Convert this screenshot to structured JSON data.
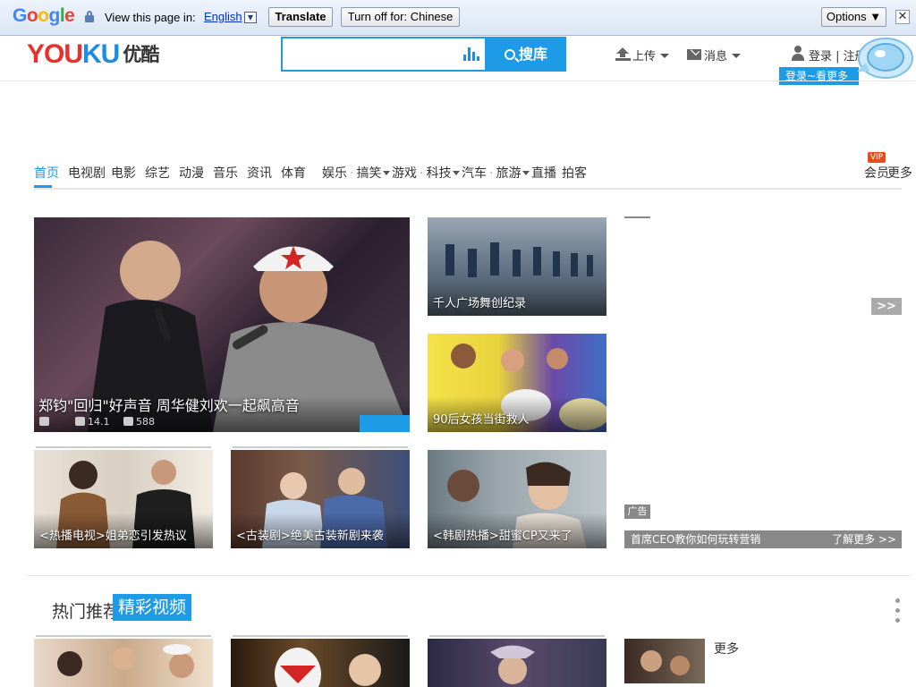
{
  "translate_bar": {
    "logo": "Google",
    "prompt": "View this page in:",
    "language": "English",
    "translate_button": "Translate",
    "turn_off_button": "Turn off for: Chinese",
    "options_button": "Options ▼",
    "close": "✕"
  },
  "header": {
    "logo_en": "YOUKU",
    "logo_cn": "优酷",
    "search_placeholder": "",
    "search_button": "搜库",
    "upload_label": "上传",
    "message_label": "消息",
    "login_label": "登录 | 注册",
    "tooltip": "登录~看更多哦"
  },
  "nav": {
    "items": [
      "首页",
      "电视剧",
      "电影",
      "综艺",
      "动漫",
      "音乐",
      "资讯",
      "体育"
    ],
    "dropdowns": [
      {
        "a": "娱乐",
        "b": "搞笑"
      },
      {
        "a": "游戏",
        "b": "科技"
      },
      {
        "a": "汽车",
        "b": "旅游"
      }
    ],
    "extra": [
      "直播",
      "拍客"
    ],
    "right": [
      "会员",
      "更多"
    ],
    "vip_badge": "VIP"
  },
  "feature": {
    "title": "郑钧\"回归\"好声音 周华健刘欢一起飙高音",
    "views": "14.1",
    "comments": "588"
  },
  "tiles": [
    {
      "caption": "千人广场舞创纪录"
    },
    {
      "caption": "90后女孩当街救人"
    },
    {
      "caption": "<热播电视>姐弟恋引发热议"
    },
    {
      "caption": "<古装剧>绝美古装新剧来袭"
    },
    {
      "caption": "<韩剧热播>甜蜜CP又来了"
    }
  ],
  "sidebar": {
    "more_button": ">>",
    "ad_tag": "广告",
    "ad_text": "首席CEO教你如何玩转营销",
    "ad_link": "了解更多 >>"
  },
  "section": {
    "tab1": "热门推荐",
    "tab2": "精彩视频",
    "side_text": "更多"
  }
}
